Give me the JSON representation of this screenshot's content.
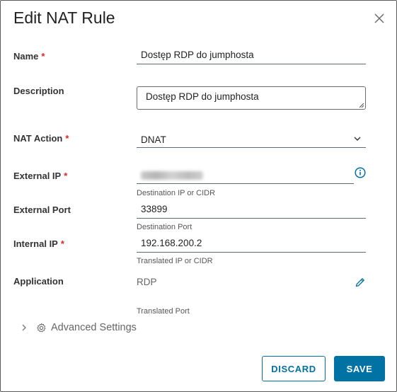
{
  "dialog": {
    "title": "Edit NAT Rule"
  },
  "fields": {
    "name": {
      "label": "Name",
      "required": "*",
      "value": "Dostęp RDP do jumphosta"
    },
    "description": {
      "label": "Description",
      "value": "Dostęp RDP do jumphosta"
    },
    "nat_action": {
      "label": "NAT Action",
      "required": "*",
      "value": "DNAT"
    },
    "external_ip": {
      "label": "External IP",
      "required": "*",
      "value": "",
      "helper": "Destination IP or CIDR"
    },
    "external_port": {
      "label": "External Port",
      "value": "33899",
      "helper": "Destination Port"
    },
    "internal_ip": {
      "label": "Internal IP",
      "required": "*",
      "value": "192.168.200.2",
      "helper": "Translated IP or CIDR"
    },
    "application": {
      "label": "Application",
      "value": "RDP",
      "helper": "Translated Port"
    }
  },
  "advanced": {
    "label": "Advanced Settings"
  },
  "buttons": {
    "discard": "DISCARD",
    "save": "SAVE"
  },
  "colors": {
    "accent": "#0072a3",
    "required": "#e02424"
  },
  "icons": [
    "close-icon",
    "chevron-down-icon",
    "info-icon",
    "pencil-icon",
    "chevron-right-icon",
    "gear-icon"
  ]
}
